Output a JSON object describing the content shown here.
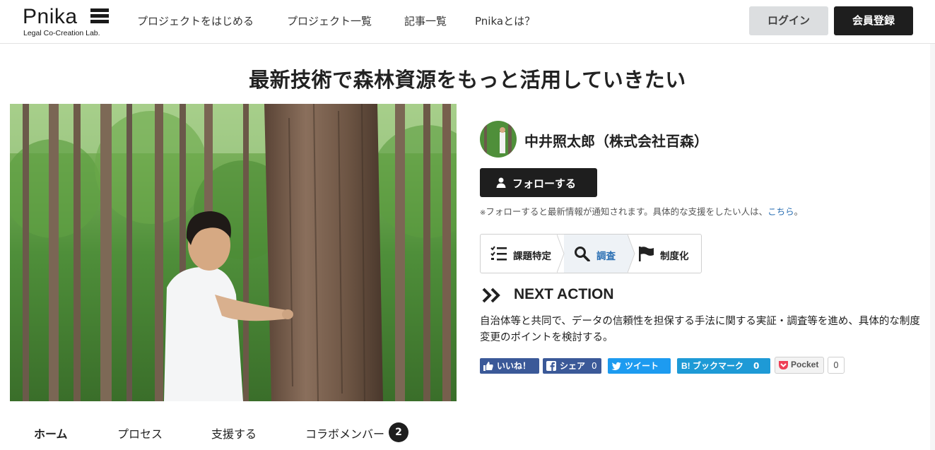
{
  "header": {
    "logo_text": "Pnika",
    "logo_sub": "Legal Co-Creation Lab.",
    "nav": [
      {
        "label": "プロジェクトをはじめる"
      },
      {
        "label": "プロジェクト一覧"
      },
      {
        "label": "記事一覧"
      },
      {
        "label": "Pnikaとは？"
      }
    ],
    "login_label": "ログイン",
    "register_label": "会員登録"
  },
  "project": {
    "title": "最新技術で森林資源をもっと活用していきたい",
    "author_name": "中井照太郎（株式会社百森）",
    "follow_label": "フォローする",
    "follow_note": "フォローすると最新情報が通知されます。具体的な支援をしたい人は、",
    "follow_note_mark": "※",
    "follow_note_link": "こちら",
    "follow_note_end": "。"
  },
  "steps": [
    {
      "label": "課題特定",
      "icon": "checklist-icon",
      "active": false
    },
    {
      "label": "調査",
      "icon": "search-icon",
      "active": true
    },
    {
      "label": "制度化",
      "icon": "flag-icon",
      "active": false
    }
  ],
  "next_action": {
    "title": "NEXT ACTION",
    "text": "自治体等と共同で、データの信頼性を担保する手法に関する実証・調査等を進め、具体的な制度変更のポイントを検討する。"
  },
  "share": {
    "like": "いいね！",
    "facebook": "シェア",
    "facebook_count": "0",
    "twitter": "ツイート",
    "hatena": "ブックマーク",
    "hatena_prefix": "B!",
    "hatena_count": "0",
    "pocket": "Pocket",
    "pocket_count": "0"
  },
  "tabs": [
    {
      "label": "ホーム",
      "active": true
    },
    {
      "label": "プロセス",
      "active": false
    },
    {
      "label": "支援する",
      "active": false
    },
    {
      "label": "コラボメンバー",
      "active": false,
      "badge": "2"
    }
  ],
  "colors": {
    "brand_dark": "#1e1e1e",
    "link_blue": "#2a6fb3",
    "facebook": "#3b5998",
    "twitter": "#1d9bf0",
    "hatena": "#1e9ad6",
    "pocket_red": "#ef3f56"
  }
}
